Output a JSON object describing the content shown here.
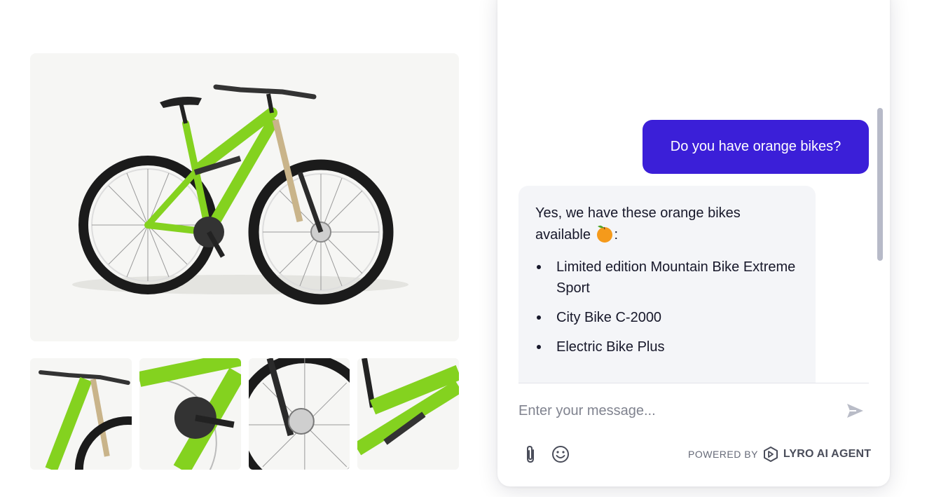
{
  "chat": {
    "user_message": "Do you have orange bikes?",
    "bot_intro_line1": "Yes, we have these orange bikes",
    "bot_intro_line2": "available",
    "bot_colon": ":",
    "bot_list": [
      "Limited edition Mountain Bike Extreme Sport",
      "City Bike C-2000",
      "Electric Bike Plus"
    ],
    "input_placeholder": "Enter your message...",
    "powered_prefix": "POWERED BY",
    "powered_brand": "LYRO AI AGENT"
  },
  "icons": {
    "send": "send-icon",
    "attach": "paperclip-icon",
    "emoji": "smiley-icon",
    "orange": "orange-emoji",
    "brand": "lyro-logo-icon"
  },
  "colors": {
    "user_bubble": "#3b1fd8",
    "bot_bubble": "#f4f5f8",
    "bike_green": "#84d21f",
    "gallery_bg": "#f6f6f4"
  }
}
